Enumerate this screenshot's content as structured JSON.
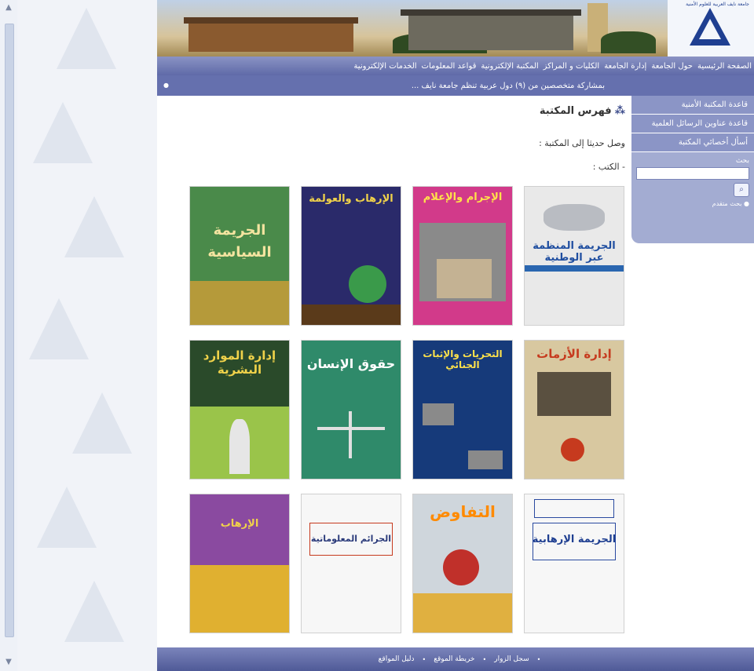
{
  "header": {
    "logo_text": "جامعة نايف العربية للعلوم الأمنية"
  },
  "nav": {
    "items": [
      "الصفحة الرئيسية",
      "حول الجامعة",
      "إدارة الجامعة",
      "الكليات و المراكز",
      "المكتبة الإلكترونية",
      "قواعد المعلومات",
      "الخدمات الإلكترونية"
    ]
  },
  "ticker": {
    "text": "بمشاركة متخصصين من (٩) دول عربية تنظم جامعة نايف ..."
  },
  "sidebar": {
    "links": [
      "قاعدة المكتبة الأمنية",
      "قاعدة عناوين الرسائل العلمية",
      "أسأل أخصائي المكتبة"
    ],
    "search_label": "بحث",
    "search_placeholder": "",
    "advanced_search": "بحث متقدم"
  },
  "main": {
    "title": "فهرس المكتبة",
    "intro": "وصل حديثا إلى المكتبة :",
    "books_label": "- الكتب :"
  },
  "books": [
    {
      "title": "الجريمة المنظمة عبر الوطنية",
      "style": "white-map"
    },
    {
      "title": "الإجرام والإعلام",
      "style": "pink"
    },
    {
      "title": "الإرهاب والعولمة",
      "style": "purple-dark"
    },
    {
      "title": "الجريمة السياسية",
      "style": "green-gold"
    },
    {
      "title": "إدارة الأزمات",
      "style": "maze"
    },
    {
      "title": "التحريات والإثبات الجنائي",
      "style": "navy-blue"
    },
    {
      "title": "حقوق الإنسان",
      "style": "teal-scales"
    },
    {
      "title": "إدارة الموارد البشرية",
      "style": "dark-green"
    },
    {
      "title": "الجريمة الإرهابية",
      "style": "white-plain"
    },
    {
      "title": "التفاوض",
      "style": "red-ball"
    },
    {
      "title": "الجرائم المعلوماتية",
      "style": "white-red"
    },
    {
      "title": "الإرهاب",
      "style": "desert"
    }
  ],
  "footer": {
    "links": [
      "سجل الزوار",
      "خريطة الموقع",
      "دليل المواقع"
    ]
  }
}
